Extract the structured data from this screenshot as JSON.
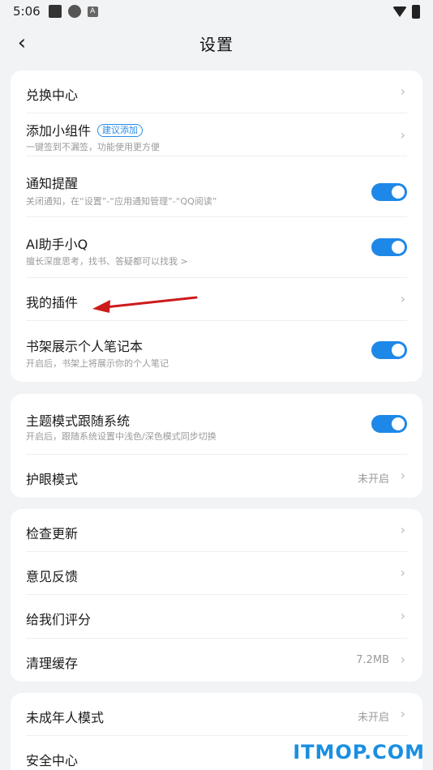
{
  "status": {
    "time": "5:06"
  },
  "header": {
    "title": "设置",
    "back_icon": "chevron-left-icon"
  },
  "card1": {
    "redeem": {
      "label": "兑换中心"
    },
    "widget": {
      "label": "添加小组件",
      "badge": "建议添加",
      "sub": "一键签到不漏签，功能使用更方便"
    },
    "notify": {
      "label": "通知提醒",
      "sub": "关闭通知，在“设置”-“应用通知管理”-“QQ阅读”",
      "on": true
    },
    "ai": {
      "label": "AI助手小Q",
      "sub": "擅长深度思考，找书、答疑都可以找我 >",
      "on": true
    },
    "plugins": {
      "label": "我的插件"
    },
    "notebook": {
      "label": "书架展示个人笔记本",
      "sub": "开启后，书架上将展示你的个人笔记",
      "on": true
    }
  },
  "card2": {
    "theme": {
      "label": "主题模式跟随系统",
      "sub": "开启后，跟随系统设置中浅色/深色模式同步切换",
      "on": true
    },
    "eye": {
      "label": "护眼模式",
      "value": "未开启"
    }
  },
  "card3": {
    "update": {
      "label": "检查更新"
    },
    "feedback": {
      "label": "意见反馈"
    },
    "rate": {
      "label": "给我们评分"
    },
    "cache": {
      "label": "清理缓存",
      "value": "7.2MB"
    }
  },
  "card4": {
    "minor": {
      "label": "未成年人模式",
      "value": "未开启"
    },
    "security": {
      "label": "安全中心"
    }
  },
  "watermark": "ITMOP.COM",
  "colors": {
    "accent": "#1e88e8",
    "annotation_arrow": "#cc1b1b"
  }
}
